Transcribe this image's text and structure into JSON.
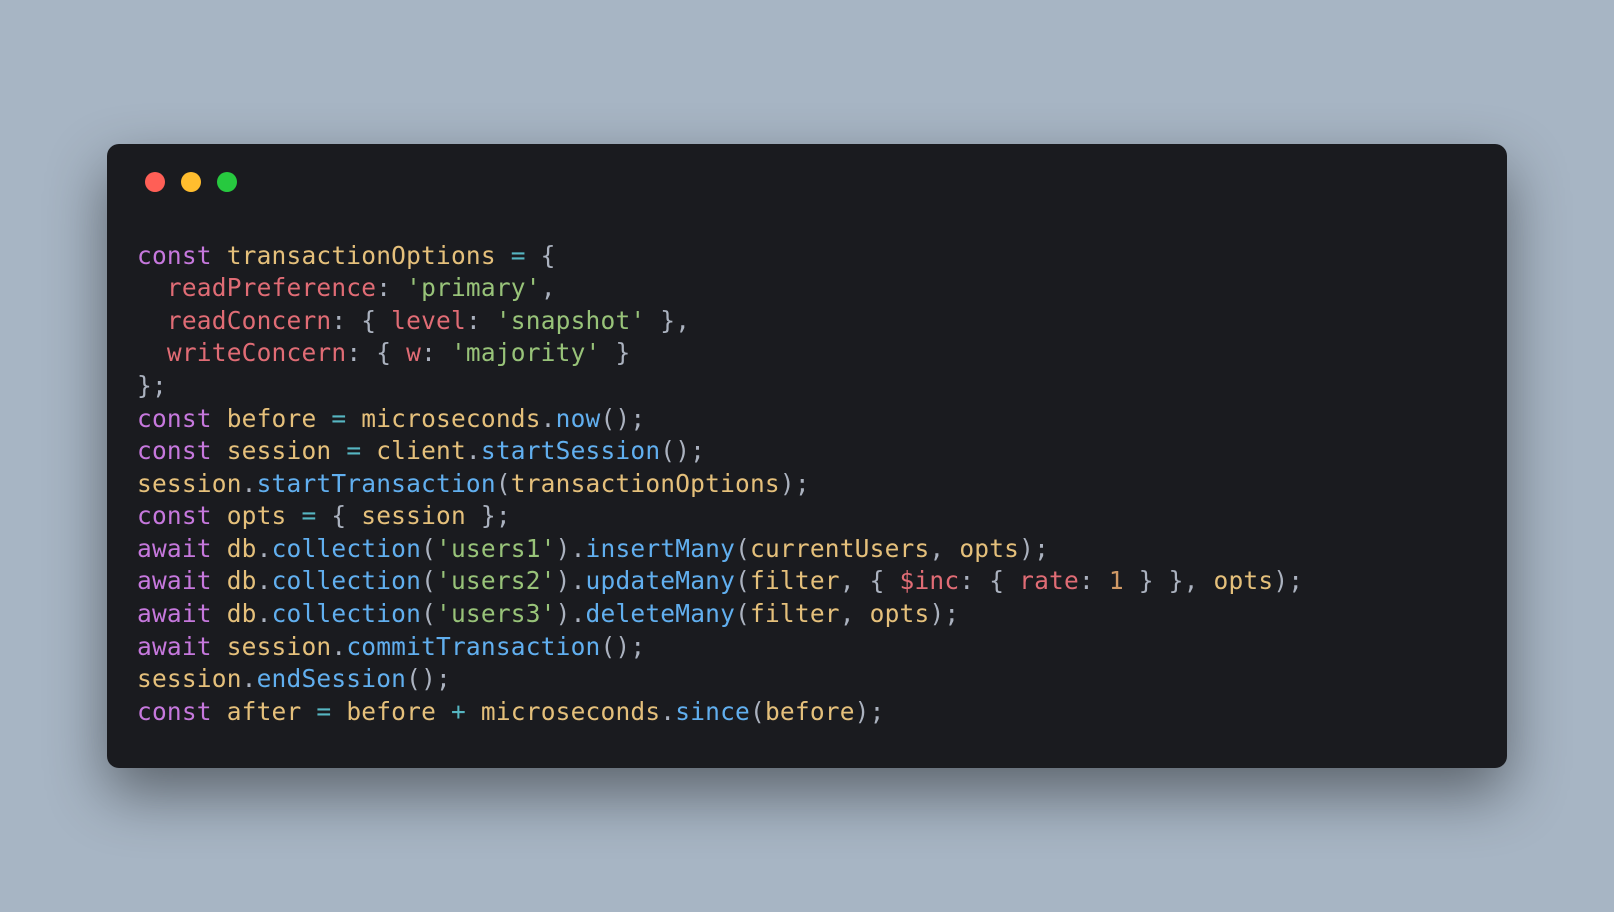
{
  "colors": {
    "background": "#a7b5c4",
    "window": "#1a1b1f",
    "red": "#ff5f56",
    "yellow": "#ffbd2e",
    "green": "#27c93f",
    "keyword": "#c678dd",
    "variable": "#61afef",
    "identifier": "#e5c07b",
    "property": "#e06c75",
    "string": "#98c379",
    "function": "#61afef",
    "number": "#d19a66",
    "operator": "#56b6c2",
    "punct": "#abb2bf"
  },
  "language": "javascript",
  "code_lines": [
    [
      {
        "t": "const ",
        "c": "kw"
      },
      {
        "t": "transactionOptions",
        "c": "id"
      },
      {
        "t": " ",
        "c": "pn"
      },
      {
        "t": "=",
        "c": "op"
      },
      {
        "t": " {",
        "c": "pn"
      }
    ],
    [
      {
        "t": "  ",
        "c": "pn"
      },
      {
        "t": "readPreference",
        "c": "prop"
      },
      {
        "t": ": ",
        "c": "pn"
      },
      {
        "t": "'primary'",
        "c": "str"
      },
      {
        "t": ",",
        "c": "pn"
      }
    ],
    [
      {
        "t": "  ",
        "c": "pn"
      },
      {
        "t": "readConcern",
        "c": "prop"
      },
      {
        "t": ": { ",
        "c": "pn"
      },
      {
        "t": "level",
        "c": "prop"
      },
      {
        "t": ": ",
        "c": "pn"
      },
      {
        "t": "'snapshot'",
        "c": "str"
      },
      {
        "t": " },",
        "c": "pn"
      }
    ],
    [
      {
        "t": "  ",
        "c": "pn"
      },
      {
        "t": "writeConcern",
        "c": "prop"
      },
      {
        "t": ": { ",
        "c": "pn"
      },
      {
        "t": "w",
        "c": "prop"
      },
      {
        "t": ": ",
        "c": "pn"
      },
      {
        "t": "'majority'",
        "c": "str"
      },
      {
        "t": " }",
        "c": "pn"
      }
    ],
    [
      {
        "t": "};",
        "c": "pn"
      }
    ],
    [
      {
        "t": "const ",
        "c": "kw"
      },
      {
        "t": "before",
        "c": "id"
      },
      {
        "t": " ",
        "c": "pn"
      },
      {
        "t": "=",
        "c": "op"
      },
      {
        "t": " ",
        "c": "pn"
      },
      {
        "t": "microseconds",
        "c": "id"
      },
      {
        "t": ".",
        "c": "pn"
      },
      {
        "t": "now",
        "c": "fn"
      },
      {
        "t": "();",
        "c": "pn"
      }
    ],
    [
      {
        "t": "const ",
        "c": "kw"
      },
      {
        "t": "session",
        "c": "id"
      },
      {
        "t": " ",
        "c": "pn"
      },
      {
        "t": "=",
        "c": "op"
      },
      {
        "t": " ",
        "c": "pn"
      },
      {
        "t": "client",
        "c": "id"
      },
      {
        "t": ".",
        "c": "pn"
      },
      {
        "t": "startSession",
        "c": "fn"
      },
      {
        "t": "();",
        "c": "pn"
      }
    ],
    [
      {
        "t": "session",
        "c": "id"
      },
      {
        "t": ".",
        "c": "pn"
      },
      {
        "t": "startTransaction",
        "c": "fn"
      },
      {
        "t": "(",
        "c": "pn"
      },
      {
        "t": "transactionOptions",
        "c": "id"
      },
      {
        "t": ");",
        "c": "pn"
      }
    ],
    [
      {
        "t": "const ",
        "c": "kw"
      },
      {
        "t": "opts",
        "c": "id"
      },
      {
        "t": " ",
        "c": "pn"
      },
      {
        "t": "=",
        "c": "op"
      },
      {
        "t": " { ",
        "c": "pn"
      },
      {
        "t": "session",
        "c": "id"
      },
      {
        "t": " };",
        "c": "pn"
      }
    ],
    [
      {
        "t": "await ",
        "c": "kw"
      },
      {
        "t": "db",
        "c": "id"
      },
      {
        "t": ".",
        "c": "pn"
      },
      {
        "t": "collection",
        "c": "fn"
      },
      {
        "t": "(",
        "c": "pn"
      },
      {
        "t": "'users1'",
        "c": "str"
      },
      {
        "t": ").",
        "c": "pn"
      },
      {
        "t": "insertMany",
        "c": "fn"
      },
      {
        "t": "(",
        "c": "pn"
      },
      {
        "t": "currentUsers",
        "c": "id"
      },
      {
        "t": ", ",
        "c": "pn"
      },
      {
        "t": "opts",
        "c": "id"
      },
      {
        "t": ");",
        "c": "pn"
      }
    ],
    [
      {
        "t": "await ",
        "c": "kw"
      },
      {
        "t": "db",
        "c": "id"
      },
      {
        "t": ".",
        "c": "pn"
      },
      {
        "t": "collection",
        "c": "fn"
      },
      {
        "t": "(",
        "c": "pn"
      },
      {
        "t": "'users2'",
        "c": "str"
      },
      {
        "t": ").",
        "c": "pn"
      },
      {
        "t": "updateMany",
        "c": "fn"
      },
      {
        "t": "(",
        "c": "pn"
      },
      {
        "t": "filter",
        "c": "id"
      },
      {
        "t": ", { ",
        "c": "pn"
      },
      {
        "t": "$inc",
        "c": "prop"
      },
      {
        "t": ": { ",
        "c": "pn"
      },
      {
        "t": "rate",
        "c": "prop"
      },
      {
        "t": ": ",
        "c": "pn"
      },
      {
        "t": "1",
        "c": "num"
      },
      {
        "t": " } }, ",
        "c": "pn"
      },
      {
        "t": "opts",
        "c": "id"
      },
      {
        "t": ");",
        "c": "pn"
      }
    ],
    [
      {
        "t": "await ",
        "c": "kw"
      },
      {
        "t": "db",
        "c": "id"
      },
      {
        "t": ".",
        "c": "pn"
      },
      {
        "t": "collection",
        "c": "fn"
      },
      {
        "t": "(",
        "c": "pn"
      },
      {
        "t": "'users3'",
        "c": "str"
      },
      {
        "t": ").",
        "c": "pn"
      },
      {
        "t": "deleteMany",
        "c": "fn"
      },
      {
        "t": "(",
        "c": "pn"
      },
      {
        "t": "filter",
        "c": "id"
      },
      {
        "t": ", ",
        "c": "pn"
      },
      {
        "t": "opts",
        "c": "id"
      },
      {
        "t": ");",
        "c": "pn"
      }
    ],
    [
      {
        "t": "await ",
        "c": "kw"
      },
      {
        "t": "session",
        "c": "id"
      },
      {
        "t": ".",
        "c": "pn"
      },
      {
        "t": "commitTransaction",
        "c": "fn"
      },
      {
        "t": "();",
        "c": "pn"
      }
    ],
    [
      {
        "t": "session",
        "c": "id"
      },
      {
        "t": ".",
        "c": "pn"
      },
      {
        "t": "endSession",
        "c": "fn"
      },
      {
        "t": "();",
        "c": "pn"
      }
    ],
    [
      {
        "t": "const ",
        "c": "kw"
      },
      {
        "t": "after",
        "c": "id"
      },
      {
        "t": " ",
        "c": "pn"
      },
      {
        "t": "=",
        "c": "op"
      },
      {
        "t": " ",
        "c": "pn"
      },
      {
        "t": "before",
        "c": "id"
      },
      {
        "t": " ",
        "c": "pn"
      },
      {
        "t": "+",
        "c": "op"
      },
      {
        "t": " ",
        "c": "pn"
      },
      {
        "t": "microseconds",
        "c": "id"
      },
      {
        "t": ".",
        "c": "pn"
      },
      {
        "t": "since",
        "c": "fn"
      },
      {
        "t": "(",
        "c": "pn"
      },
      {
        "t": "before",
        "c": "id"
      },
      {
        "t": ");",
        "c": "pn"
      }
    ]
  ]
}
